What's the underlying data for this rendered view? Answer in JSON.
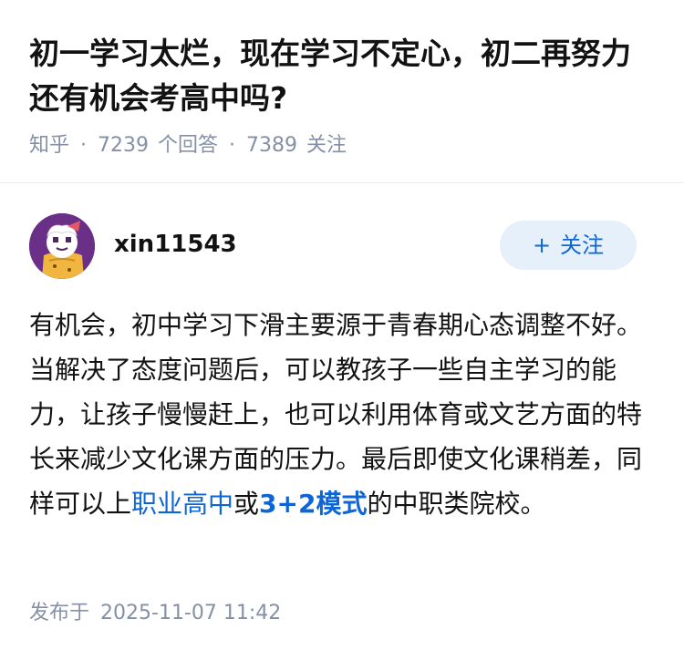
{
  "question": {
    "title": "初一学习太烂，现在学习不定心，初二再努力还有机会考高中吗?",
    "source": "知乎",
    "separator": "·",
    "answer_count": "7239",
    "answer_count_label": "个回答",
    "follower_count": "7389",
    "follower_count_label": "关注"
  },
  "author": {
    "name": "xin11543",
    "follow_button": {
      "icon": "+",
      "label": "关注"
    },
    "avatar_icon": "avatar-icon"
  },
  "answer": {
    "text_before_link1": "有机会，初中学习下滑主要源于青春期心态调整不好。当解决了态度问题后，可以教孩子一些自主学习的能力，让孩子慢慢赶上，也可以利用体育或文艺方面的特长来减少文化课方面的压力。最后即使文化课稍差，同样可以上",
    "link1": "职业高中",
    "text_between": "或",
    "link2": "3+2模式",
    "text_after": "的中职类院校。"
  },
  "publish": {
    "label": "发布于",
    "datetime": "2025-11-07 11:42"
  },
  "colors": {
    "accent": "#0e66d6",
    "meta_gray": "#8590a6",
    "follow_bg": "#e5f0fb",
    "avatar_bg": "#6a2f86"
  }
}
